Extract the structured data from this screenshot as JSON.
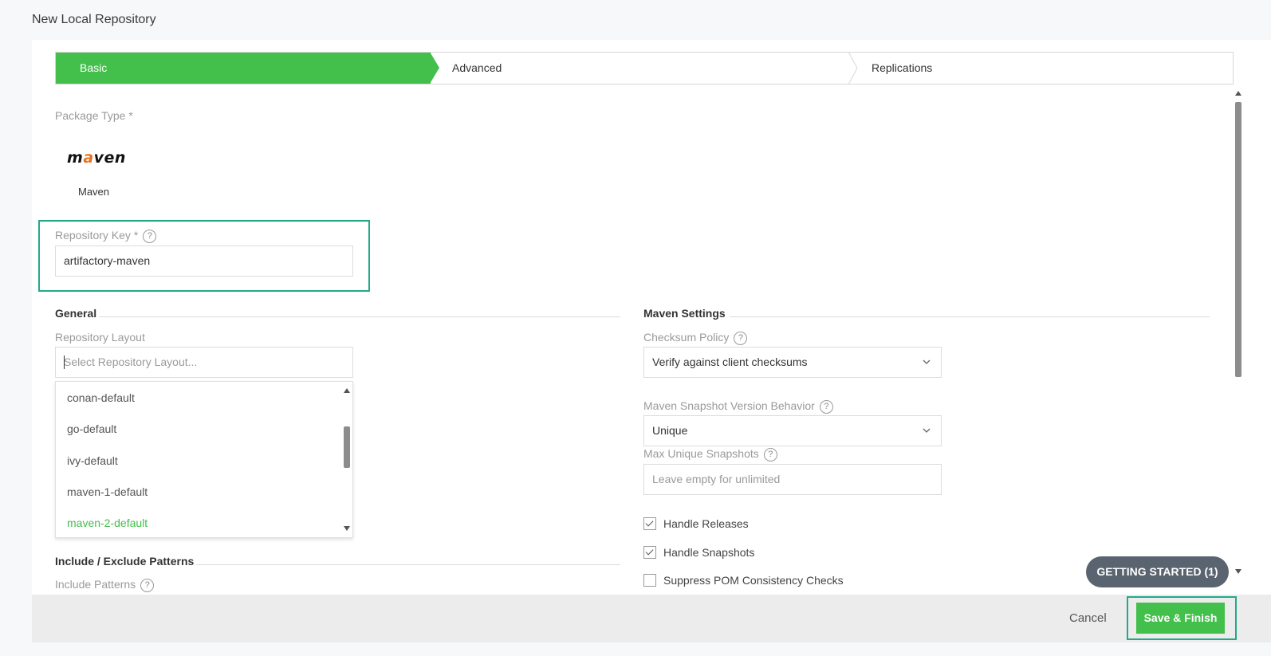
{
  "page": {
    "title": "New Local Repository"
  },
  "wizard": {
    "steps": [
      {
        "label": "Basic",
        "active": true
      },
      {
        "label": "Advanced",
        "active": false
      },
      {
        "label": "Replications",
        "active": false
      }
    ]
  },
  "package_type": {
    "label": "Package Type *",
    "logo_text_pre": "m",
    "logo_text_accent": "a",
    "logo_text_post": "ven",
    "name": "Maven"
  },
  "repository_key": {
    "label": "Repository Key *",
    "help": "?",
    "value": "artifactory-maven"
  },
  "general": {
    "heading": "General",
    "layout_label": "Repository Layout",
    "layout_placeholder": "Select Repository Layout...",
    "layout_options": [
      "conan-default",
      "go-default",
      "ivy-default",
      "maven-1-default",
      "maven-2-default"
    ],
    "selected_option": "maven-2-default"
  },
  "include_exclude": {
    "heading": "Include / Exclude Patterns",
    "include_label": "Include Patterns"
  },
  "maven_settings": {
    "heading": "Maven Settings",
    "checksum_label": "Checksum Policy",
    "checksum_value": "Verify against client checksums",
    "snapshot_label": "Maven Snapshot Version Behavior",
    "snapshot_value": "Unique",
    "max_label": "Max Unique Snapshots",
    "max_placeholder": "Leave empty for unlimited",
    "checkboxes": [
      {
        "label": "Handle Releases",
        "checked": true
      },
      {
        "label": "Handle Snapshots",
        "checked": true
      },
      {
        "label": "Suppress POM Consistency Checks",
        "checked": false
      }
    ]
  },
  "footer": {
    "cancel": "Cancel",
    "save": "Save & Finish",
    "getting_started": "GETTING STARTED (1)"
  },
  "colors": {
    "accent": "#43bf4b",
    "highlight": "#22a98a",
    "pill": "#5a6470"
  }
}
